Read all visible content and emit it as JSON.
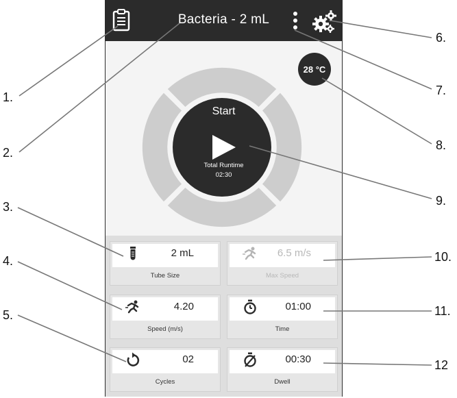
{
  "header": {
    "title": "Bacteria - 2 mL"
  },
  "temperature": {
    "value": "28 °C"
  },
  "start": {
    "label": "Start",
    "runtime_label": "Total Runtime",
    "runtime_value": "02:30"
  },
  "cards": [
    {
      "value": "2 mL",
      "label": "Tube Size",
      "icon": "tube-icon",
      "enabled": true
    },
    {
      "value": "6.5 m/s",
      "label": "Max Speed",
      "icon": "runner-icon",
      "enabled": false
    },
    {
      "value": "4.20",
      "label": "Speed (m/s)",
      "icon": "runner-icon",
      "enabled": true
    },
    {
      "value": "01:00",
      "label": "Time",
      "icon": "stopwatch-icon",
      "enabled": true
    },
    {
      "value": "02",
      "label": "Cycles",
      "icon": "cycle-icon",
      "enabled": true
    },
    {
      "value": "00:30",
      "label": "Dwell",
      "icon": "dwell-timer-icon",
      "enabled": true
    }
  ],
  "callouts": [
    "1.",
    "2.",
    "3.",
    "4.",
    "5.",
    "6.",
    "7.",
    "8.",
    "9.",
    "10.",
    "11.",
    "12"
  ],
  "colors": {
    "dark": "#2b2b2b",
    "ring": "#cdcdcd",
    "panel": "#dedede"
  }
}
